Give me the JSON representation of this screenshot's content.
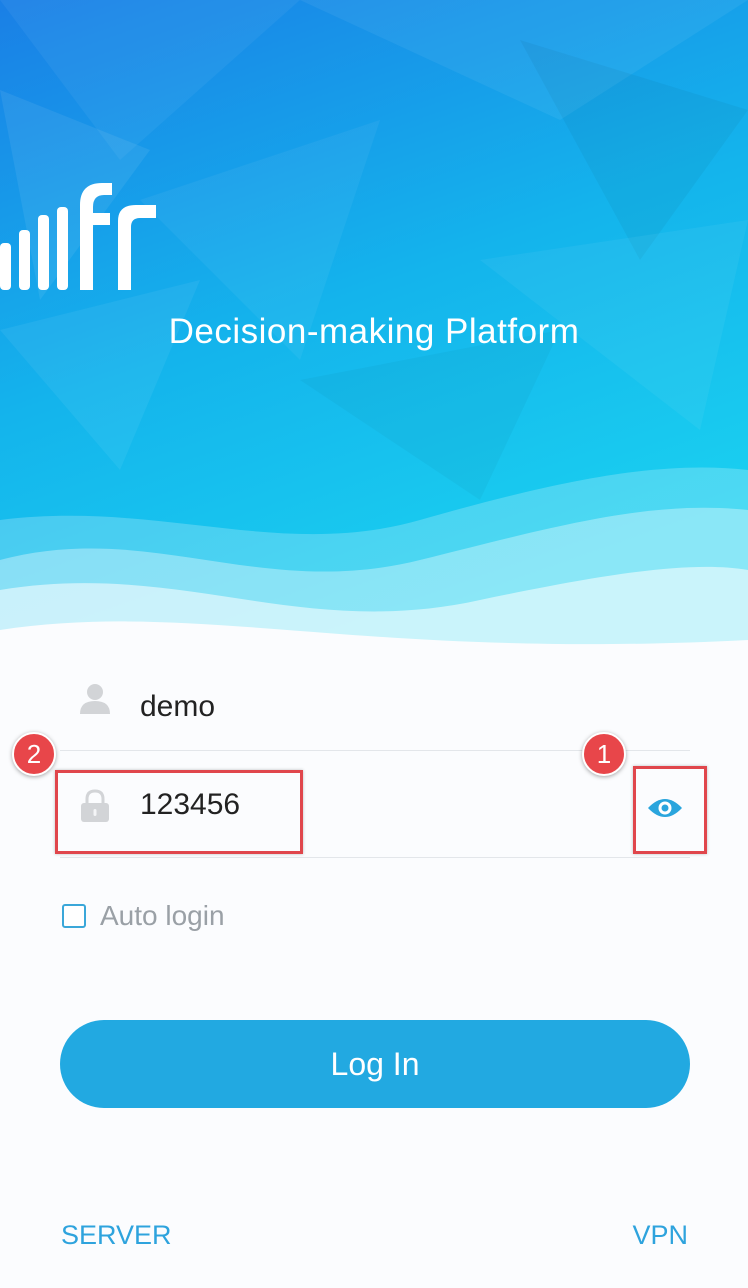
{
  "header": {
    "logo_icon": "fr-logo-icon",
    "title": "Decision-making Platform"
  },
  "login_form": {
    "username": {
      "icon": "user-icon",
      "value": "demo"
    },
    "password": {
      "icon": "lock-icon",
      "value": "123456",
      "toggle_icon": "eye-icon"
    },
    "auto_login": {
      "label": "Auto login",
      "checked": false
    },
    "login_button": "Log In"
  },
  "annotations": [
    {
      "badge": "1",
      "target": "show-password-eye-icon"
    },
    {
      "badge": "2",
      "target": "password-field"
    }
  ],
  "footer": {
    "server_label": "SERVER",
    "vpn_label": "VPN"
  },
  "colors": {
    "accent": "#22a9e1",
    "annotation": "#e0464c",
    "hero_top": "#1a86e6",
    "hero_bottom": "#17c3ef"
  }
}
